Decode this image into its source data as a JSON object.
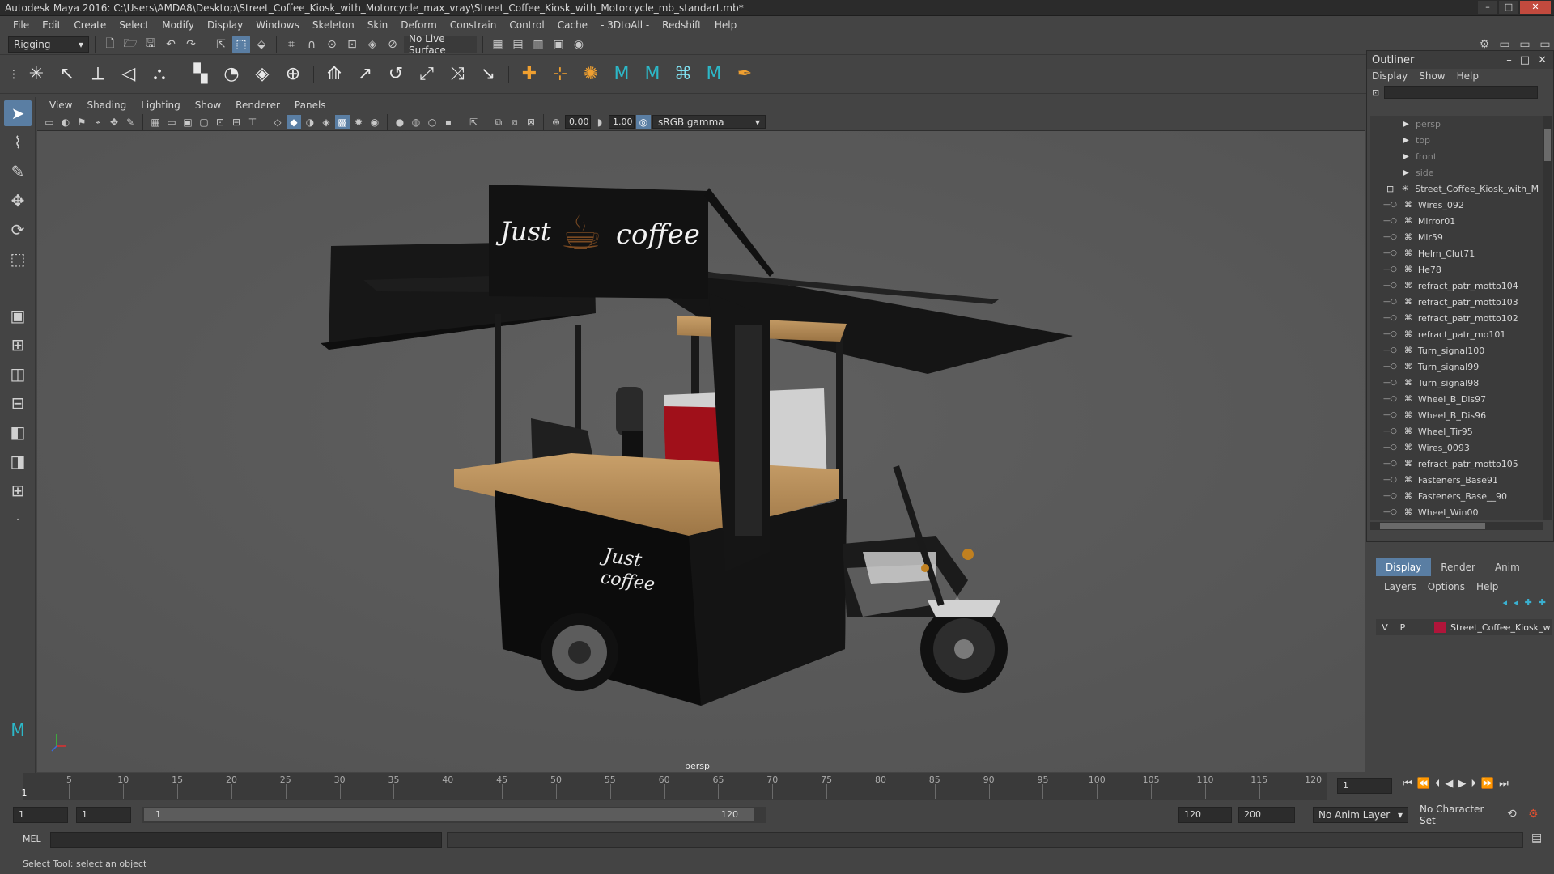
{
  "window": {
    "title": "Autodesk Maya 2016: C:\\Users\\AMDA8\\Desktop\\Street_Coffee_Kiosk_with_Motorcycle_max_vray\\Street_Coffee_Kiosk_with_Motorcycle_mb_standart.mb*",
    "controls": [
      "–",
      "□",
      "✕"
    ]
  },
  "menubar": [
    "File",
    "Edit",
    "Create",
    "Select",
    "Modify",
    "Display",
    "Windows",
    "Skeleton",
    "Skin",
    "Deform",
    "Constrain",
    "Control",
    "Cache",
    "- 3DtoAll -",
    "Redshift",
    "Help"
  ],
  "statusline": {
    "mode": "Rigging",
    "live_surface": "No Live Surface"
  },
  "viewport": {
    "menus": [
      "View",
      "Shading",
      "Lighting",
      "Show",
      "Renderer",
      "Panels"
    ],
    "exposure": "0.00",
    "gamma": "1.00",
    "color_space": "sRGB gamma",
    "camera": "persp",
    "sign_left": "Just",
    "sign_right": "coffee",
    "cart_text_1": "Just",
    "cart_text_2": "coffee"
  },
  "outliner": {
    "title": "Outliner",
    "menus": [
      "Display",
      "Show",
      "Help"
    ],
    "items": [
      {
        "label": "persp",
        "dim": true,
        "indent": 1
      },
      {
        "label": "top",
        "dim": true,
        "indent": 1
      },
      {
        "label": "front",
        "dim": true,
        "indent": 1
      },
      {
        "label": "side",
        "dim": true,
        "indent": 1
      },
      {
        "label": "Street_Coffee_Kiosk_with_M",
        "dim": false,
        "indent": 0
      },
      {
        "label": "Wires_092",
        "dim": false,
        "indent": 2
      },
      {
        "label": "Mirror01",
        "dim": false,
        "indent": 2
      },
      {
        "label": "Mir59",
        "dim": false,
        "indent": 2
      },
      {
        "label": "Helm_Clut71",
        "dim": false,
        "indent": 2
      },
      {
        "label": "He78",
        "dim": false,
        "indent": 2
      },
      {
        "label": "refract_patr_motto104",
        "dim": false,
        "indent": 2
      },
      {
        "label": "refract_patr_motto103",
        "dim": false,
        "indent": 2
      },
      {
        "label": "refract_patr_motto102",
        "dim": false,
        "indent": 2
      },
      {
        "label": "refract_patr_mo101",
        "dim": false,
        "indent": 2
      },
      {
        "label": "Turn_signal100",
        "dim": false,
        "indent": 2
      },
      {
        "label": "Turn_signal99",
        "dim": false,
        "indent": 2
      },
      {
        "label": "Turn_signal98",
        "dim": false,
        "indent": 2
      },
      {
        "label": "Wheel_B_Dis97",
        "dim": false,
        "indent": 2
      },
      {
        "label": "Wheel_B_Dis96",
        "dim": false,
        "indent": 2
      },
      {
        "label": "Wheel_Tir95",
        "dim": false,
        "indent": 2
      },
      {
        "label": "Wires_0093",
        "dim": false,
        "indent": 2
      },
      {
        "label": "refract_patr_motto105",
        "dim": false,
        "indent": 2
      },
      {
        "label": "Fasteners_Base91",
        "dim": false,
        "indent": 2
      },
      {
        "label": "Fasteners_Base__90",
        "dim": false,
        "indent": 2
      },
      {
        "label": "Wheel_Win00",
        "dim": false,
        "indent": 2
      }
    ]
  },
  "layers": {
    "tabs": [
      "Display",
      "Render",
      "Anim"
    ],
    "menus": [
      "Layers",
      "Options",
      "Help"
    ],
    "layer": {
      "v": "V",
      "p": "P",
      "name": "Street_Coffee_Kiosk_w",
      "color": "#b0153a"
    }
  },
  "timeslider": {
    "ticks": [
      5,
      10,
      15,
      20,
      25,
      30,
      35,
      40,
      45,
      50,
      55,
      60,
      65,
      70,
      75,
      80,
      85,
      90,
      95,
      100,
      105,
      110,
      115,
      120
    ],
    "start_mark": "1",
    "current_frame": "1"
  },
  "range": {
    "start": "1",
    "playback_start": "1",
    "slider_start": "1",
    "slider_end": "120",
    "playback_end": "120",
    "end": "200",
    "anim_layer": "No Anim Layer",
    "character_set": "No Character Set"
  },
  "cmdline": {
    "lang": "MEL"
  },
  "helpline": {
    "text": "Select Tool: select an object"
  },
  "colors": {
    "accent": "#5a7ea3",
    "viewport_bg": "#5a5a5a",
    "layer_color": "#b0153a"
  }
}
